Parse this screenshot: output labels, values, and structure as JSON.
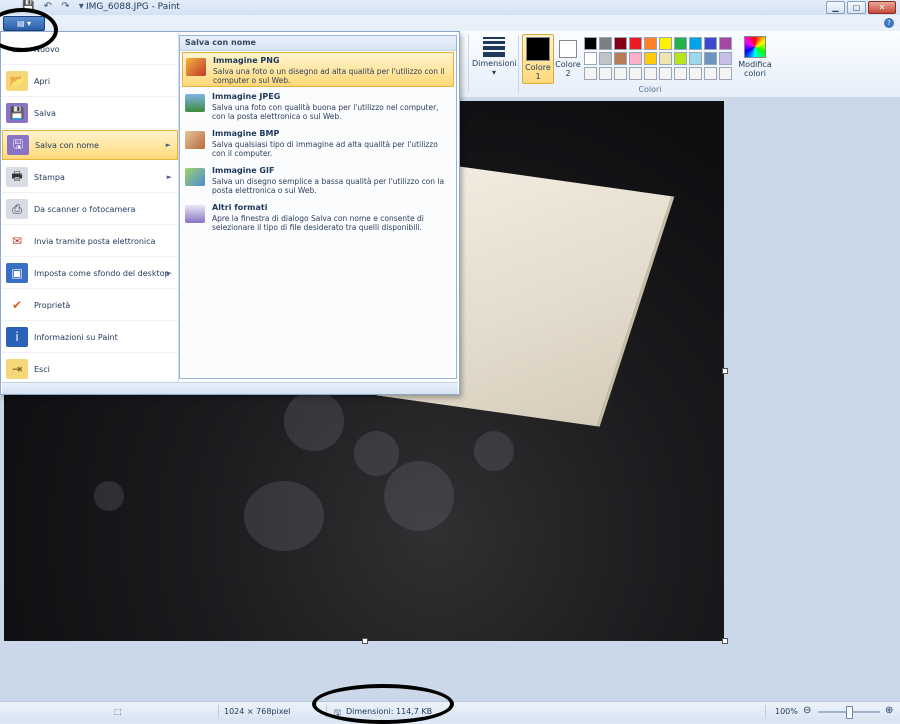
{
  "window": {
    "title": "IMG_6088.JPG - Paint",
    "controls": {
      "minimize": "▁",
      "maximize": "▢",
      "close": "✕"
    },
    "help_glyph": "?"
  },
  "quick_access": {
    "save": "💾",
    "undo": "↶",
    "redo": "↷",
    "dropdown": "▾"
  },
  "app_button": {
    "label": "▤ ▾"
  },
  "ribbon": {
    "dimensions_label": "Dimensioni",
    "dimensions_arrow": "▾",
    "color1_label": "Colore 1",
    "color2_label": "Colore 2",
    "edit_colors_label": "Modifica colori",
    "group_label": "Colori",
    "palette": [
      "#000000",
      "#7f7f7f",
      "#880015",
      "#ed1c24",
      "#ff7f27",
      "#fff200",
      "#22b14c",
      "#00a2e8",
      "#3f48cc",
      "#a349a4",
      "#ffffff",
      "#c3c3c3",
      "#b97a57",
      "#ffaec9",
      "#ffc90e",
      "#efe4b0",
      "#b5e61d",
      "#99d9ea",
      "#7092be",
      "#c8bfe7",
      "#f4f4f4",
      "#f4f4f4",
      "#f4f4f4",
      "#f4f4f4",
      "#f4f4f4",
      "#f4f4f4",
      "#f4f4f4",
      "#f4f4f4",
      "#f4f4f4",
      "#f4f4f4"
    ]
  },
  "file_menu": {
    "items": [
      {
        "label": "Nuovo",
        "icon": "new-file-icon"
      },
      {
        "label": "Apri",
        "icon": "open-folder-icon"
      },
      {
        "label": "Salva",
        "icon": "save-disk-icon"
      },
      {
        "label": "Salva con nome",
        "icon": "save-as-icon",
        "arrow": "►"
      },
      {
        "label": "Stampa",
        "icon": "printer-icon",
        "arrow": "►"
      },
      {
        "label": "Da scanner o fotocamera",
        "icon": "scanner-icon"
      },
      {
        "label": "Invia tramite posta elettronica",
        "icon": "email-icon"
      },
      {
        "label": "Imposta come sfondo del desktop",
        "icon": "desktop-background-icon",
        "arrow": "►"
      },
      {
        "label": "Proprietà",
        "icon": "checkmark-icon"
      },
      {
        "label": "Informazioni su Paint",
        "icon": "info-icon"
      },
      {
        "label": "Esci",
        "icon": "exit-icon"
      }
    ]
  },
  "save_as_submenu": {
    "header": "Salva con nome",
    "items": [
      {
        "title": "Immagine PNG",
        "desc": "Salva una foto o un disegno ad alta qualità per l'utilizzo con il computer o sul Web."
      },
      {
        "title": "Immagine JPEG",
        "desc": "Salva una foto con qualità buona per l'utilizzo nel computer, con la posta elettronica o sul Web."
      },
      {
        "title": "Immagine BMP",
        "desc": "Salva qualsiasi tipo di immagine ad alta qualità per l'utilizzo con il computer."
      },
      {
        "title": "Immagine GIF",
        "desc": "Salva un disegno semplice a bassa qualità per l'utilizzo con la posta elettronica o sul Web."
      },
      {
        "title": "Altri formati",
        "desc": "Apre la finestra di dialogo Salva con nome e consente di selezionare il tipo di file desiderato tra quelli disponibili."
      }
    ]
  },
  "status_bar": {
    "selection_icon": "⬚",
    "image_size": "1024 × 768pixel",
    "file_size": "Dimensioni: 114,7 KB",
    "zoom": "100%",
    "zoom_out": "⊖",
    "zoom_in": "⊕"
  }
}
